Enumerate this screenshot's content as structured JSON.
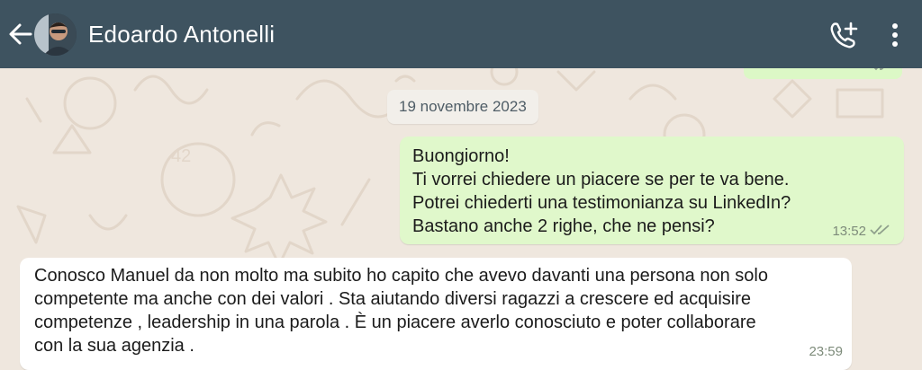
{
  "header": {
    "contact_name": "Edoardo Antonelli",
    "back_icon": "arrow-left-icon",
    "call_icon": "add-call-icon",
    "menu_icon": "more-vertical-icon",
    "color": "#3e5360"
  },
  "chat": {
    "date_separator": "19 novembre 2023",
    "outgoing_message": {
      "lines": [
        "Buongiorno!",
        "Ti vorrei chiedere un piacere se per te va bene.",
        "Potrei chiederti una testimonianza su LinkedIn?",
        "Bastano anche 2 righe, che ne pensi?"
      ],
      "time": "13:52",
      "status_icon": "double-check-icon",
      "color": "#e0f8cb"
    },
    "incoming_message": {
      "lines": [
        "Conosco Manuel da non molto ma subito ho capito che avevo davanti una persona non solo",
        "competente ma anche con dei valori . Sta aiutando diversi ragazzi a crescere ed acquisire",
        "competenze , leadership in una parola . È un piacere averlo conosciuto e poter collaborare",
        "con la sua agenzia ."
      ],
      "time": "23:59",
      "color": "#ffffff"
    },
    "wallpaper_color": "#efe7de"
  }
}
